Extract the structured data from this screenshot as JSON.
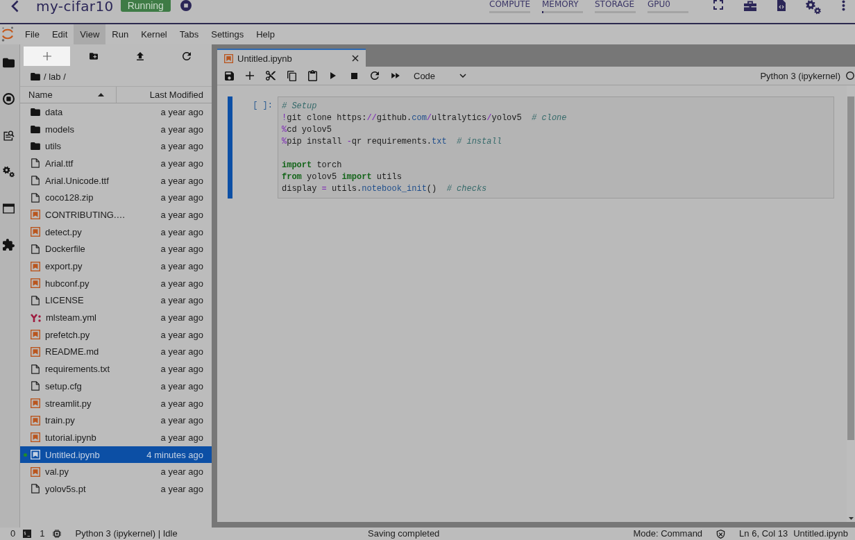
{
  "header": {
    "title": "my-cifar10",
    "status": "Running",
    "meters": [
      {
        "label": "COMPUTE"
      },
      {
        "label": "MEMORY",
        "level": 0.03
      },
      {
        "label": "STORAGE"
      },
      {
        "label": "GPU0"
      }
    ]
  },
  "menu_bar": {
    "items": [
      {
        "label": "File",
        "selected": false
      },
      {
        "label": "Edit",
        "selected": false
      },
      {
        "label": "View",
        "selected": true
      },
      {
        "label": "Run",
        "selected": false
      },
      {
        "label": "Kernel",
        "selected": false
      },
      {
        "label": "Tabs",
        "selected": false
      },
      {
        "label": "Settings",
        "selected": false
      },
      {
        "label": "Help",
        "selected": false
      }
    ]
  },
  "file_browser": {
    "breadcrumb": "/ lab /",
    "columns": [
      {
        "label": "Name",
        "sorted": true
      },
      {
        "label": "Last Modified",
        "sorted": false
      }
    ],
    "files": [
      {
        "name": "data",
        "kind": "folder",
        "modified": "a year ago",
        "selected": false,
        "running": false
      },
      {
        "name": "models",
        "kind": "folder",
        "modified": "a year ago",
        "selected": false,
        "running": false
      },
      {
        "name": "utils",
        "kind": "folder",
        "modified": "a year ago",
        "selected": false,
        "running": false
      },
      {
        "name": "Arial.ttf",
        "kind": "file",
        "modified": "a year ago",
        "selected": false,
        "running": false
      },
      {
        "name": "Arial.Unicode.ttf",
        "kind": "file",
        "modified": "a year ago",
        "selected": false,
        "running": false
      },
      {
        "name": "coco128.zip",
        "kind": "file",
        "modified": "a year ago",
        "selected": false,
        "running": false
      },
      {
        "name": "CONTRIBUTING.…",
        "kind": "notebook",
        "modified": "a year ago",
        "selected": false,
        "running": false
      },
      {
        "name": "detect.py",
        "kind": "notebook",
        "modified": "a year ago",
        "selected": false,
        "running": false
      },
      {
        "name": "Dockerfile",
        "kind": "file",
        "modified": "a year ago",
        "selected": false,
        "running": false
      },
      {
        "name": "export.py",
        "kind": "notebook",
        "modified": "a year ago",
        "selected": false,
        "running": false
      },
      {
        "name": "hubconf.py",
        "kind": "notebook",
        "modified": "a year ago",
        "selected": false,
        "running": false
      },
      {
        "name": "LICENSE",
        "kind": "file",
        "modified": "a year ago",
        "selected": false,
        "running": false
      },
      {
        "name": "mlsteam.yml",
        "kind": "yaml",
        "modified": "a year ago",
        "selected": false,
        "running": false
      },
      {
        "name": "prefetch.py",
        "kind": "notebook",
        "modified": "a year ago",
        "selected": false,
        "running": false
      },
      {
        "name": "README.md",
        "kind": "notebook",
        "modified": "a year ago",
        "selected": false,
        "running": false
      },
      {
        "name": "requirements.txt",
        "kind": "file",
        "modified": "a year ago",
        "selected": false,
        "running": false
      },
      {
        "name": "setup.cfg",
        "kind": "file",
        "modified": "a year ago",
        "selected": false,
        "running": false
      },
      {
        "name": "streamlit.py",
        "kind": "notebook",
        "modified": "a year ago",
        "selected": false,
        "running": false
      },
      {
        "name": "train.py",
        "kind": "notebook",
        "modified": "a year ago",
        "selected": false,
        "running": false
      },
      {
        "name": "tutorial.ipynb",
        "kind": "notebook",
        "modified": "a year ago",
        "selected": false,
        "running": false
      },
      {
        "name": "Untitled.ipynb",
        "kind": "notebook",
        "modified": "4 minutes ago",
        "selected": true,
        "running": true
      },
      {
        "name": "val.py",
        "kind": "notebook",
        "modified": "a year ago",
        "selected": false,
        "running": false
      },
      {
        "name": "yolov5s.pt",
        "kind": "file",
        "modified": "a year ago",
        "selected": false,
        "running": false
      }
    ]
  },
  "tabs": [
    {
      "label": "Untitled.ipynb",
      "selected": true
    }
  ],
  "notebook": {
    "cell_type": "Code",
    "kernel": "Python 3 (ipykernel)",
    "kernel_busy": false,
    "cells": [
      {
        "prompt": "[ ]:",
        "active": true,
        "lines": [
          {
            "kind": "code",
            "tokens": [
              {
                "text": "# Setup",
                "kind": "comment"
              }
            ]
          },
          {
            "kind": "code",
            "tokens": [
              {
                "text": "!",
                "kind": "operator"
              },
              {
                "text": "git clone https:",
                "kind": "plain"
              },
              {
                "text": "//",
                "kind": "operator"
              },
              {
                "text": "github.",
                "kind": "plain"
              },
              {
                "text": "com",
                "kind": "property"
              },
              {
                "text": "/",
                "kind": "operator"
              },
              {
                "text": "ultralytics",
                "kind": "plain"
              },
              {
                "text": "/",
                "kind": "operator"
              },
              {
                "text": "yolov5",
                "kind": "plain"
              },
              {
                "text": "  # clone",
                "kind": "comment"
              }
            ]
          },
          {
            "kind": "code",
            "tokens": [
              {
                "text": "%",
                "kind": "operator"
              },
              {
                "text": "cd yolov5",
                "kind": "plain"
              }
            ]
          },
          {
            "kind": "code",
            "tokens": [
              {
                "text": "%",
                "kind": "operator"
              },
              {
                "text": "pip install ",
                "kind": "plain"
              },
              {
                "text": "-",
                "kind": "operator"
              },
              {
                "text": "qr requirements.",
                "kind": "plain"
              },
              {
                "text": "txt",
                "kind": "property"
              },
              {
                "text": "  # install",
                "kind": "comment"
              }
            ]
          },
          {
            "kind": "blank"
          },
          {
            "kind": "code",
            "tokens": [
              {
                "text": "import",
                "kind": "keyword"
              },
              {
                "text": " torch",
                "kind": "plain"
              }
            ]
          },
          {
            "kind": "code",
            "tokens": [
              {
                "text": "from",
                "kind": "keyword"
              },
              {
                "text": " yolov5 ",
                "kind": "plain"
              },
              {
                "text": "import",
                "kind": "keyword"
              },
              {
                "text": " utils",
                "kind": "plain"
              }
            ]
          },
          {
            "kind": "code",
            "tokens": [
              {
                "text": "display ",
                "kind": "plain"
              },
              {
                "text": "=",
                "kind": "operator"
              },
              {
                "text": " utils.",
                "kind": "plain"
              },
              {
                "text": "notebook_init",
                "kind": "property"
              },
              {
                "text": "()",
                "kind": "plain"
              },
              {
                "text": "  # checks",
                "kind": "comment"
              }
            ]
          }
        ]
      }
    ]
  },
  "status_bar": {
    "terminals": "0",
    "kernels": "1",
    "kernel_status": "Python 3 (ipykernel) | Idle",
    "message": "Saving completed",
    "mode": "Mode: Command",
    "cursor": "Ln 6, Col 13",
    "file": "Untitled.ipynb"
  }
}
